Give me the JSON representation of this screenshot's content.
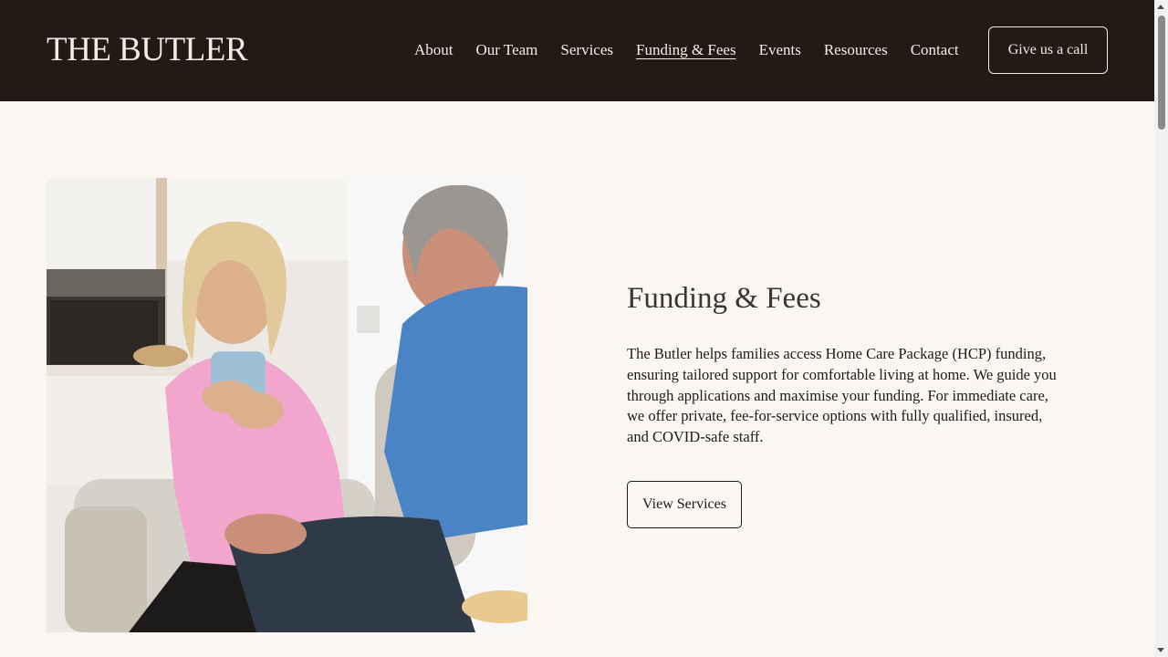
{
  "header": {
    "logo": "THE BUTLER",
    "nav": [
      {
        "label": "About",
        "active": false
      },
      {
        "label": "Our Team",
        "active": false
      },
      {
        "label": "Services",
        "active": false
      },
      {
        "label": "Funding & Fees",
        "active": true
      },
      {
        "label": "Events",
        "active": false
      },
      {
        "label": "Resources",
        "active": false
      },
      {
        "label": "Contact",
        "active": false
      }
    ],
    "cta_label": "Give us a call"
  },
  "main": {
    "photo_icon": "photo-elderly-couple-icon",
    "title": "Funding & Fees",
    "body": "The Butler helps families access Home Care Package (HCP) funding, ensuring tailored support for comfortable living at home. We guide you through applications and maximise your funding. For immediate care, we offer private, fee-for-service options with fully qualified, insured, and COVID-safe staff.",
    "button_label": "View Services"
  },
  "colors": {
    "header_bg": "#241a15",
    "page_bg": "#faf7f2",
    "header_text": "#f4ece0",
    "title_text": "#3b3431"
  }
}
